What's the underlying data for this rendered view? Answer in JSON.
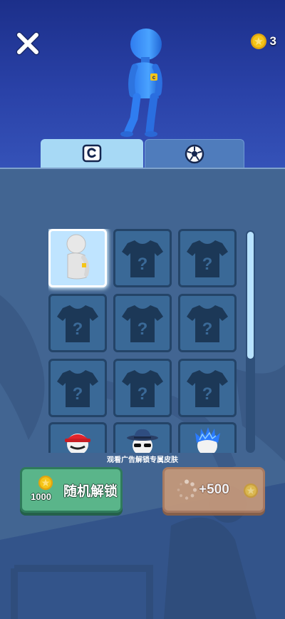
{
  "header": {
    "coin_count": "3"
  },
  "tabs": [
    {
      "icon": "jersey-c-icon",
      "active": true
    },
    {
      "icon": "soccer-ball-icon",
      "active": false
    }
  ],
  "skins": {
    "grid": [
      {
        "state": "selected",
        "icon": "white-character-icon"
      },
      {
        "state": "locked",
        "icon": "jersey-question-icon"
      },
      {
        "state": "locked",
        "icon": "jersey-question-icon"
      },
      {
        "state": "locked",
        "icon": "jersey-question-icon"
      },
      {
        "state": "locked",
        "icon": "jersey-question-icon"
      },
      {
        "state": "locked",
        "icon": "jersey-question-icon"
      },
      {
        "state": "locked",
        "icon": "jersey-question-icon"
      },
      {
        "state": "locked",
        "icon": "jersey-question-icon"
      },
      {
        "state": "locked",
        "icon": "jersey-question-icon"
      },
      {
        "state": "partial",
        "icon": "red-cap-head-icon"
      },
      {
        "state": "partial",
        "icon": "fedora-sunglasses-head-icon"
      },
      {
        "state": "partial",
        "icon": "blue-spiky-hair-head-icon"
      }
    ],
    "question_mark": "?"
  },
  "ad_note": "观看广告解锁专属皮肤",
  "random_unlock": {
    "price": "1000",
    "label": "随机解锁"
  },
  "watch_ad": {
    "reward": "+500"
  },
  "colors": {
    "accent_blue": "#a7d9f5",
    "green_button": "#5ab58a",
    "tan_button": "#c79a7a",
    "coin_gold": "#f5c518"
  }
}
